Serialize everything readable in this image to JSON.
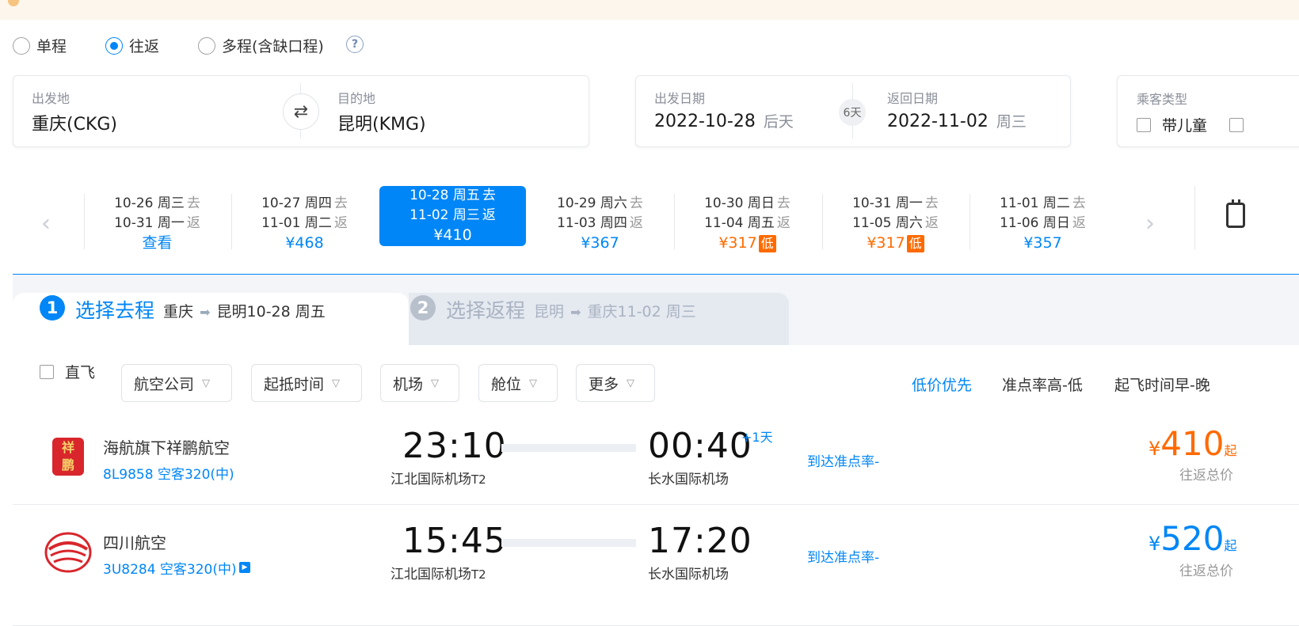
{
  "trip_types": [
    {
      "label": "单程",
      "checked": false
    },
    {
      "label": "往返",
      "checked": true
    },
    {
      "label": "多程(含缺口程)",
      "checked": false
    }
  ],
  "help_icon": "?",
  "search": {
    "from_label": "出发地",
    "from_value": "重庆(CKG)",
    "swap_icon": "⇄",
    "to_label": "目的地",
    "to_value": "昆明(KMG)",
    "depart_label": "出发日期",
    "depart_value": "2022-10-28",
    "depart_sub": "后天",
    "days": "6天",
    "return_label": "返回日期",
    "return_value": "2022-11-02",
    "return_sub": "周三",
    "passenger_label": "乘客类型",
    "passenger_child": "带儿童"
  },
  "date_strip": [
    {
      "d1": "10-26  周三",
      "t1": "去",
      "d2": "10-31  周一",
      "t2": "返",
      "price": "查看",
      "low": false,
      "tag": ""
    },
    {
      "d1": "10-27  周四",
      "t1": "去",
      "d2": "11-01  周二",
      "t2": "返",
      "price": "¥468",
      "low": false,
      "tag": ""
    },
    {
      "d1": "10-28  周五",
      "t1": "去",
      "d2": "11-02  周三",
      "t2": "返",
      "price": "¥410",
      "low": false,
      "tag": ""
    },
    {
      "d1": "10-29  周六",
      "t1": "去",
      "d2": "11-03  周四",
      "t2": "返",
      "price": "¥367",
      "low": false,
      "tag": ""
    },
    {
      "d1": "10-30  周日",
      "t1": "去",
      "d2": "11-04  周五",
      "t2": "返",
      "price": "¥317",
      "low": true,
      "tag": "低"
    },
    {
      "d1": "10-31  周一",
      "t1": "去",
      "d2": "11-05  周六",
      "t2": "返",
      "price": "¥317",
      "low": true,
      "tag": "低"
    },
    {
      "d1": "11-01  周二",
      "t1": "去",
      "d2": "11-06  周日",
      "t2": "返",
      "price": "¥357",
      "low": false,
      "tag": ""
    }
  ],
  "steps": {
    "step1_num": "1",
    "step1_title": "选择去程",
    "step1_route_a": "重庆",
    "step1_route_b": "昆明10-28 周五",
    "step2_num": "2",
    "step2_title": "选择返程",
    "step2_route_a": "昆明",
    "step2_route_b": "重庆11-02 周三"
  },
  "filters": {
    "direct": "直飞",
    "buttons": [
      "航空公司",
      "起抵时间",
      "机场",
      "舱位",
      "更多"
    ],
    "sort": [
      "低价优先",
      "准点率高-低",
      "起飞时间早-晚"
    ]
  },
  "flights": [
    {
      "airline": "海航旗下祥鹏航空",
      "flight_no": "8L9858 空客320(中)",
      "dep_time": "23:10",
      "dep_airport": "江北国际机场",
      "dep_terminal": "T2",
      "arr_time": "00:40",
      "arr_airport": "长水国际机场",
      "plus_day": "+1天",
      "ontime": "到达准点率-",
      "yen": "¥",
      "price": "410",
      "qi": "起",
      "total": "往返总价",
      "price_color": "#ff6a00",
      "logo": "xiangpeng-logo-icon"
    },
    {
      "airline": "四川航空",
      "flight_no": "3U8284 空客320(中)",
      "dep_time": "15:45",
      "dep_airport": "江北国际机场",
      "dep_terminal": "T2",
      "arr_time": "17:20",
      "arr_airport": "长水国际机场",
      "plus_day": "",
      "ontime": "到达准点率-",
      "yen": "¥",
      "price": "520",
      "qi": "起",
      "total": "往返总价",
      "price_color": "#0086f6",
      "logo": "sichuan-airlines-logo-icon"
    }
  ],
  "colors": {
    "accent": "#0086f6",
    "low_price": "#ff6a00"
  }
}
